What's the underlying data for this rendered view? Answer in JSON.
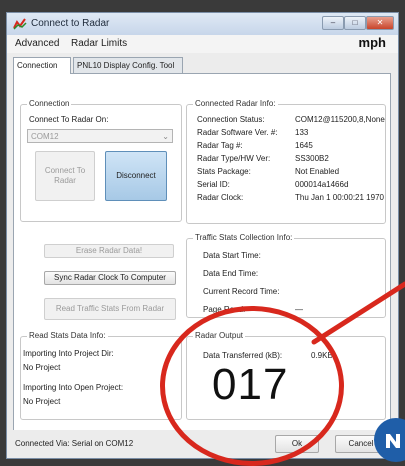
{
  "window": {
    "title": "Connect to Radar",
    "units": "mph",
    "controls": {
      "minimize": "–",
      "maximize": "□",
      "close": "✕"
    }
  },
  "menu": [
    "Advanced",
    "Radar Limits"
  ],
  "tabs": [
    "Connection",
    "PNL10 Display Config. Tool"
  ],
  "connection": {
    "group_label": "Connection",
    "connect_label": "Connect To Radar On:",
    "port_value": "COM12",
    "connect_button": "Connect To\nRadar",
    "disconnect_button": "Disconnect"
  },
  "actions": {
    "erase": "Erase Radar Data!",
    "sync": "Sync Radar Clock To Computer",
    "read": "Read Traffic Stats From Radar"
  },
  "radar_info": {
    "group_label": "Connected Radar Info:",
    "rows": [
      {
        "label": "Connection Status:",
        "value": "COM12@115200,8,None"
      },
      {
        "label": "Radar Software Ver. #:",
        "value": "133"
      },
      {
        "label": "Radar Tag #:",
        "value": "1645"
      },
      {
        "label": "Radar Type/HW Ver:",
        "value": "SS300B2"
      },
      {
        "label": "Stats Package:",
        "value": "Not Enabled"
      },
      {
        "label": "Serial ID:",
        "value": "000014a1466d"
      },
      {
        "label": "Radar Clock:",
        "value": "Thu Jan  1 00:00:21 1970"
      }
    ]
  },
  "traffic": {
    "group_label": "Traffic Stats Collection Info:",
    "rows": [
      {
        "label": "Data Start Time:",
        "value": ""
      },
      {
        "label": "Data End Time:",
        "value": ""
      },
      {
        "label": "Current Record Time:",
        "value": ""
      },
      {
        "label": "Page Read:",
        "value": "—"
      }
    ]
  },
  "read_stats": {
    "group_label": "Read Stats Data Info:",
    "importing_dir_label": "Importing Into Project Dir:",
    "importing_dir_value": "No Project",
    "importing_open_label": "Importing Into Open Project:",
    "importing_open_value": "No Project"
  },
  "radar_output": {
    "group_label": "Radar Output",
    "data_label": "Data Transferred (kB):",
    "data_value": "0.9KB",
    "count": "017"
  },
  "status": {
    "connected_via": "Connected Via: Serial on COM12",
    "ok": "Ok",
    "cancel": "Cancel"
  },
  "colors": {
    "annotation": "#d8281d",
    "badge": "#1f5ea8"
  }
}
